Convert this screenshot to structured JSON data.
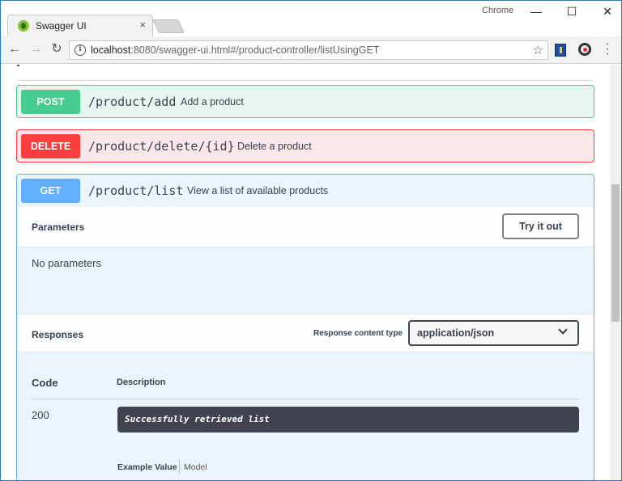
{
  "browser": {
    "tab_title": "Swagger UI",
    "tab_close": "×",
    "profile_label": "Chrome",
    "window_controls": {
      "minimize": "—",
      "maximize": "☐",
      "close": "✕"
    },
    "url_host": "localhost",
    "url_rest": ":8080/swagger-ui.html#/product-controller/listUsingGET",
    "icons": [
      "back-icon",
      "forward-icon",
      "reload-icon",
      "info-icon",
      "star-icon",
      "extension-icon",
      "extension-icon",
      "menu-icon"
    ]
  },
  "operations": [
    {
      "method": "POST",
      "path": "/product/add",
      "summary": "Add a product",
      "color": "#49cc90"
    },
    {
      "method": "DELETE",
      "path": "/product/delete/{id}",
      "summary": "Delete a product",
      "color": "#f93e3e"
    },
    {
      "method": "GET",
      "path": "/product/list",
      "summary": "View a list of available products",
      "color": "#61affe"
    }
  ],
  "get_detail": {
    "parameters_title": "Parameters",
    "try_it_out": "Try it out",
    "no_parameters": "No parameters",
    "responses_title": "Responses",
    "response_content_type_label": "Response content type",
    "response_content_type_value": "application/json",
    "table_headers": {
      "code": "Code",
      "description": "Description"
    },
    "responses": [
      {
        "code": "200",
        "description": "Successfully retrieved list"
      }
    ],
    "example_tabs": {
      "example_value": "Example Value",
      "model": "Model"
    }
  }
}
